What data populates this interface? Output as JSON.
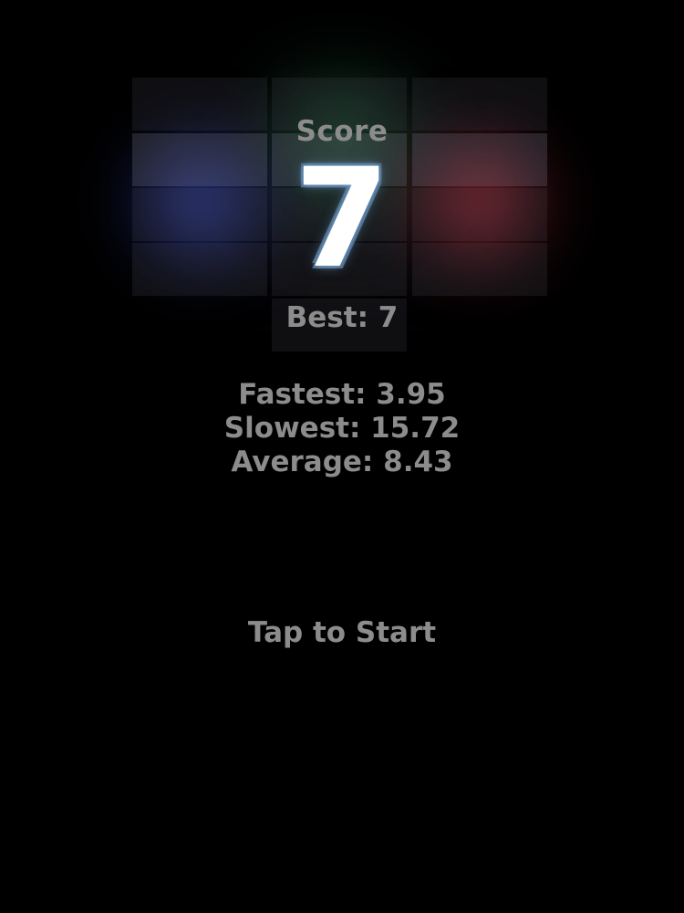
{
  "score": {
    "label": "Score",
    "value": "7"
  },
  "best": {
    "text": "Best: 7"
  },
  "stats": {
    "fastest": "Fastest: 3.95",
    "slowest": "Slowest: 15.72",
    "average": "Average: 8.43"
  },
  "start": {
    "label": "Tap to Start"
  },
  "colors": {
    "background": "#000000",
    "text_muted": "#8c8c8c",
    "score_text": "#ffffff",
    "glow_blue": "#3a4fc0",
    "glow_red": "#b82d3c",
    "glow_green": "#287846"
  }
}
